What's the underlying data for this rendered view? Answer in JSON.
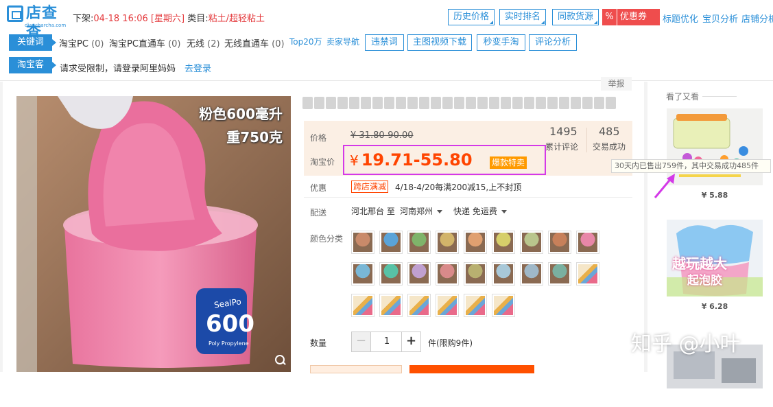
{
  "plugin": {
    "logo": {
      "name": "店查查",
      "url": "diancharcha.com"
    },
    "offline_label": "下架:",
    "offline_date": "04-18 16:06",
    "offline_weekday": "[星期六]",
    "category_label": "类目:",
    "category": "粘土/超轻粘土",
    "buttons": [
      "历史价格",
      "实时排名",
      "同款货源"
    ],
    "coupon": {
      "pct": "%",
      "label": "优惠券"
    },
    "right_links": [
      "标题优化",
      "宝贝分析",
      "店铺分析"
    ],
    "keywords_tag": "关键词",
    "keywords": [
      {
        "name": "淘宝PC",
        "count": "(0)"
      },
      {
        "name": "淘宝PC直通车",
        "count": "(0)"
      },
      {
        "name": "无线",
        "count": "(2)"
      },
      {
        "name": "无线直通车",
        "count": "(0)"
      }
    ],
    "links": [
      "Top20万",
      "卖家导航"
    ],
    "keyword_buttons": [
      "违禁词",
      "主图视频下载",
      "秒变手淘",
      "评论分析"
    ],
    "taobaoke_tag": "淘宝客",
    "taobaoke_msg": "请求受限制，请登录阿里妈妈",
    "taobaoke_login": "去登录"
  },
  "product": {
    "report": "举报",
    "image_caption_1": "粉色600毫升",
    "image_caption_2": "重750克",
    "jar_text_brand": "SealPo",
    "jar_text_num": "600",
    "jar_text_sub": "Poly Propylene",
    "price_label": "价格",
    "old_price": "¥ 31.80-90.00",
    "taobao_price_label": "淘宝价",
    "currency": "¥",
    "current_price": "19.71-55.80",
    "hot_badge": "爆款特卖",
    "reviews_count": "1495",
    "reviews_label": "累计评论",
    "deals_count": "485",
    "deals_label": "交易成功",
    "promo_label": "优惠",
    "promo_badge": "跨店满减",
    "promo_text": "4/18-4/20每满200减15,上不封顶",
    "delivery_label": "配送",
    "delivery_from": "河北邢台 至",
    "delivery_to": "河南郑州",
    "delivery_method": "快递 免运费",
    "color_label": "颜色分类",
    "quantity_label": "数量",
    "quantity": "1",
    "quantity_limit": "件(限购9件)"
  },
  "side": {
    "header": "看了又看",
    "tooltip": "30天内已售出759件，其中交易成功485件",
    "items": [
      {
        "price": "¥ 5.88"
      },
      {
        "price": "¥ 6.28"
      }
    ],
    "thumb2_caption_1": "越玩越大",
    "thumb2_caption_2": "起泡胶"
  },
  "watermark": "知乎 @小叶",
  "colors": {
    "accent": "#2a8fd8",
    "price": "#ff4400",
    "highlight": "#d439e8",
    "coupon": "#ef4d4d"
  }
}
